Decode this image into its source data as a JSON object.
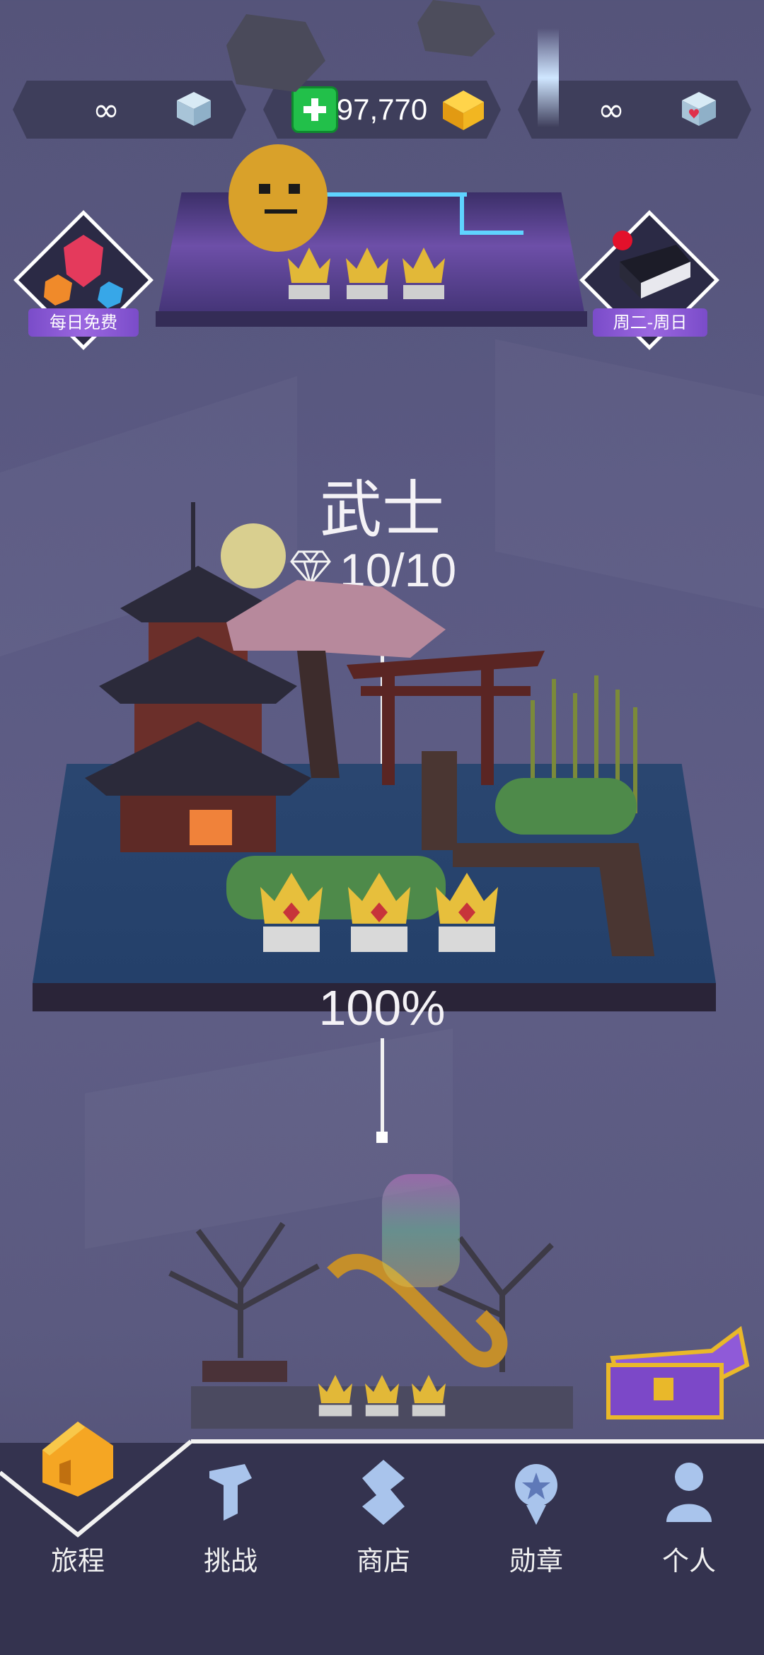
{
  "topbar": {
    "left_counter": "∞",
    "center_gems": "97,770",
    "right_counter": "∞"
  },
  "badges": {
    "daily_free_label": "每日免费",
    "weekday_label": "周二-周日"
  },
  "level": {
    "title": "武士",
    "score": "10/10",
    "progress": "100%"
  },
  "nav": {
    "journey": "旅程",
    "challenge": "挑战",
    "shop": "商店",
    "medals": "勋章",
    "profile": "个人"
  },
  "colors": {
    "background": "#5a5982",
    "accent_purple": "#8a5ad6",
    "gem_gold": "#f2b621",
    "plus_green": "#22c04a"
  }
}
